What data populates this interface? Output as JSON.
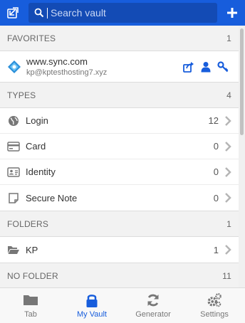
{
  "colors": {
    "brand": "#175ddc",
    "search_bg": "#134bb5",
    "icon_gray": "#777777"
  },
  "header": {
    "search_placeholder": "Search vault",
    "popout_icon": "popout-icon",
    "add_icon": "plus-icon"
  },
  "favorites": {
    "title": "FAVORITES",
    "count": "1",
    "items": [
      {
        "name": "www.sync.com",
        "subtitle": "kp@kptesthosting7.xyz",
        "icon": "site-favicon"
      }
    ]
  },
  "types": {
    "title": "TYPES",
    "count": "4",
    "items": [
      {
        "label": "Login",
        "count": "12",
        "icon": "globe-icon"
      },
      {
        "label": "Card",
        "count": "0",
        "icon": "credit-card-icon"
      },
      {
        "label": "Identity",
        "count": "0",
        "icon": "id-card-icon"
      },
      {
        "label": "Secure Note",
        "count": "0",
        "icon": "sticky-note-icon"
      }
    ]
  },
  "folders": {
    "title": "FOLDERS",
    "count": "1",
    "items": [
      {
        "label": "KP",
        "count": "1",
        "icon": "folder-open-icon"
      }
    ]
  },
  "no_folder": {
    "title": "NO FOLDER",
    "count": "11"
  },
  "tabs": [
    {
      "label": "Tab",
      "icon": "folder-icon",
      "active": false
    },
    {
      "label": "My Vault",
      "icon": "lock-icon",
      "active": true
    },
    {
      "label": "Generator",
      "icon": "refresh-icon",
      "active": false
    },
    {
      "label": "Settings",
      "icon": "cogs-icon",
      "active": false
    }
  ]
}
